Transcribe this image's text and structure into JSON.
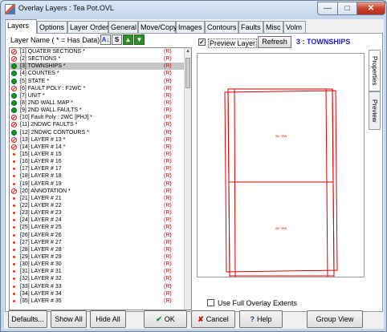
{
  "window": {
    "title": "Overlay Layers : Tea Pot.OVL",
    "minimize": "—",
    "maximize": "□",
    "close": "✕"
  },
  "tabs": [
    {
      "label": "Layers"
    },
    {
      "label": "Options"
    },
    {
      "label": "Layer Order"
    },
    {
      "label": "General"
    },
    {
      "label": "Move/Copy"
    },
    {
      "label": "Images"
    },
    {
      "label": "Contours"
    },
    {
      "label": "Faults"
    },
    {
      "label": "Misc"
    },
    {
      "label": "Volm"
    }
  ],
  "layers_panel": {
    "header": "Layer Name ( * = Has Data)",
    "sort_label": "A↓",
    "select_label": "S",
    "up_label": "▲",
    "down_label": "▼",
    "items": [
      {
        "icon": "no-entry-icon",
        "text": "[1] QUATER SECTIONS *",
        "flag": "(R)"
      },
      {
        "icon": "no-entry-icon",
        "text": "[2] SECTIONS *",
        "flag": "(R)"
      },
      {
        "icon": "green-circle-icon",
        "text": "[3] TOWNSHIPS *",
        "flag": "(R)"
      },
      {
        "icon": "green-circle-icon",
        "text": "[4] COUNTES *",
        "flag": "(R)"
      },
      {
        "icon": "green-circle-icon",
        "text": "[5] STATE *",
        "flag": "(R)"
      },
      {
        "icon": "no-entry-icon",
        "text": "[6] FAULT POLY : F2WC *",
        "flag": "(R)"
      },
      {
        "icon": "green-circle-icon",
        "text": "[7] UNIT *",
        "flag": "(R)"
      },
      {
        "icon": "green-circle-icon",
        "text": "[8] 2ND WALL MAP *",
        "flag": "(R)"
      },
      {
        "icon": "green-circle-icon",
        "text": "[9] 2ND WALL FAULTS *",
        "flag": "(R)"
      },
      {
        "icon": "no-entry-icon",
        "text": "[10] Fault Poly : 2WC [PHJ] *",
        "flag": "(R)"
      },
      {
        "icon": "no-entry-icon",
        "text": "[11] 2NDWC FAULTS *",
        "flag": "(R)"
      },
      {
        "icon": "green-circle-icon",
        "text": "[12] 2NDWC CONTOURS *",
        "flag": "(R)"
      },
      {
        "icon": "no-entry-icon",
        "text": "[13] LAYER # 13 *",
        "flag": "(R)"
      },
      {
        "icon": "no-entry-icon",
        "text": "[14] LAYER # 14 *",
        "flag": "(R)"
      },
      {
        "icon": "dot-icon",
        "text": "[15] LAYER # 15",
        "flag": "(R)"
      },
      {
        "icon": "dot-icon",
        "text": "[16] LAYER # 16",
        "flag": "(R)"
      },
      {
        "icon": "dot-icon",
        "text": "[17] LAYER # 17",
        "flag": "(R)"
      },
      {
        "icon": "dot-icon",
        "text": "[18] LAYER # 18",
        "flag": "(R)"
      },
      {
        "icon": "dot-icon",
        "text": "[19] LAYER # 19",
        "flag": "(R)"
      },
      {
        "icon": "no-entry-icon",
        "text": "[20] ANNOTATION *",
        "flag": "(R)"
      },
      {
        "icon": "dot-icon",
        "text": "[21] LAYER # 21",
        "flag": "(R)"
      },
      {
        "icon": "dot-icon",
        "text": "[22] LAYER # 22",
        "flag": "(R)"
      },
      {
        "icon": "dot-icon",
        "text": "[23] LAYER # 23",
        "flag": "(R)"
      },
      {
        "icon": "dot-icon",
        "text": "[24] LAYER # 24",
        "flag": "(R)"
      },
      {
        "icon": "dot-icon",
        "text": "[25] LAYER # 25",
        "flag": "(R)"
      },
      {
        "icon": "dot-icon",
        "text": "[26] LAYER # 26",
        "flag": "(R)"
      },
      {
        "icon": "dot-icon",
        "text": "[27] LAYER # 27",
        "flag": "(R)"
      },
      {
        "icon": "dot-icon",
        "text": "[28] LAYER # 28",
        "flag": "(R)"
      },
      {
        "icon": "dot-icon",
        "text": "[29] LAYER # 29",
        "flag": "(R)"
      },
      {
        "icon": "dot-icon",
        "text": "[30] LAYER # 30",
        "flag": "(R)"
      },
      {
        "icon": "dot-icon",
        "text": "[31] LAYER # 31",
        "flag": "(R)"
      },
      {
        "icon": "dot-icon",
        "text": "[32] LAYER # 32",
        "flag": "(R)"
      },
      {
        "icon": "dot-icon",
        "text": "[33] LAYER # 33",
        "flag": "(R)"
      },
      {
        "icon": "dot-icon",
        "text": "[34] LAYER # 34",
        "flag": "(R)"
      },
      {
        "icon": "dot-icon",
        "text": "[35] LAYER # 35",
        "flag": "(R)"
      }
    ],
    "selected_index": 2
  },
  "preview": {
    "preview_layer_label": "Preview Layer",
    "preview_layer_checked": true,
    "refresh_label": "Refresh",
    "current_layer_title": "3 : TOWNSHIPS",
    "map_label_top": "3N 78W",
    "map_label_bottom": "4N 78W",
    "full_extents_label": "Use Full Overlay Extents",
    "full_extents_checked": false,
    "line_color": "#e00000"
  },
  "side_tabs": [
    {
      "label": "Properties"
    },
    {
      "label": "Preview"
    }
  ],
  "buttons": {
    "defaults": "Defaults...",
    "show_all": "Show All",
    "hide_all": "Hide All",
    "ok": "OK",
    "cancel": "Cancel",
    "help": "Help",
    "group_view": "Group View"
  }
}
